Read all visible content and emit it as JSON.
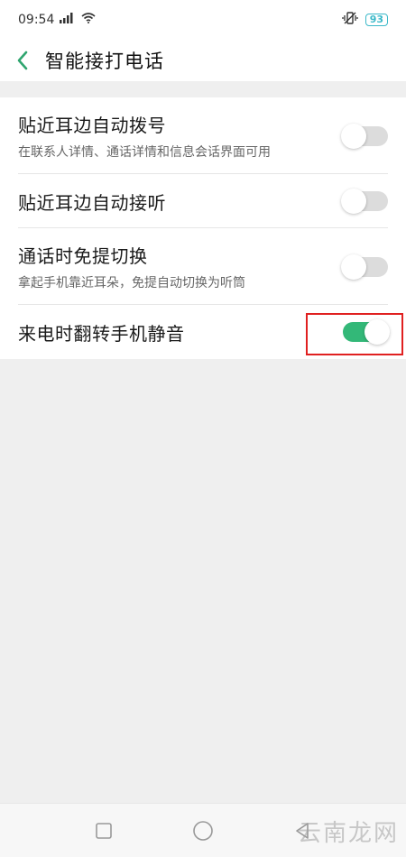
{
  "status_bar": {
    "time": "09:54",
    "signal_icon": "signal-icon",
    "wifi_icon": "wifi-icon",
    "vibrate_icon": "vibrate-icon",
    "battery_level": "93"
  },
  "header": {
    "title": "智能接打电话",
    "back_icon": "back-arrow-icon"
  },
  "settings": [
    {
      "title": "贴近耳边自动拨号",
      "subtitle": "在联系人详情、通话详情和信息会话界面可用",
      "enabled": false
    },
    {
      "title": "贴近耳边自动接听",
      "subtitle": "",
      "enabled": false
    },
    {
      "title": "通话时免提切换",
      "subtitle": "拿起手机靠近耳朵，免提自动切换为听筒",
      "enabled": false
    },
    {
      "title": "来电时翻转手机静音",
      "subtitle": "",
      "enabled": true
    }
  ],
  "colors": {
    "accent": "#33b878",
    "back_arrow": "#2fa56f",
    "highlight_box": "#e02020"
  },
  "watermark": "云南龙网"
}
